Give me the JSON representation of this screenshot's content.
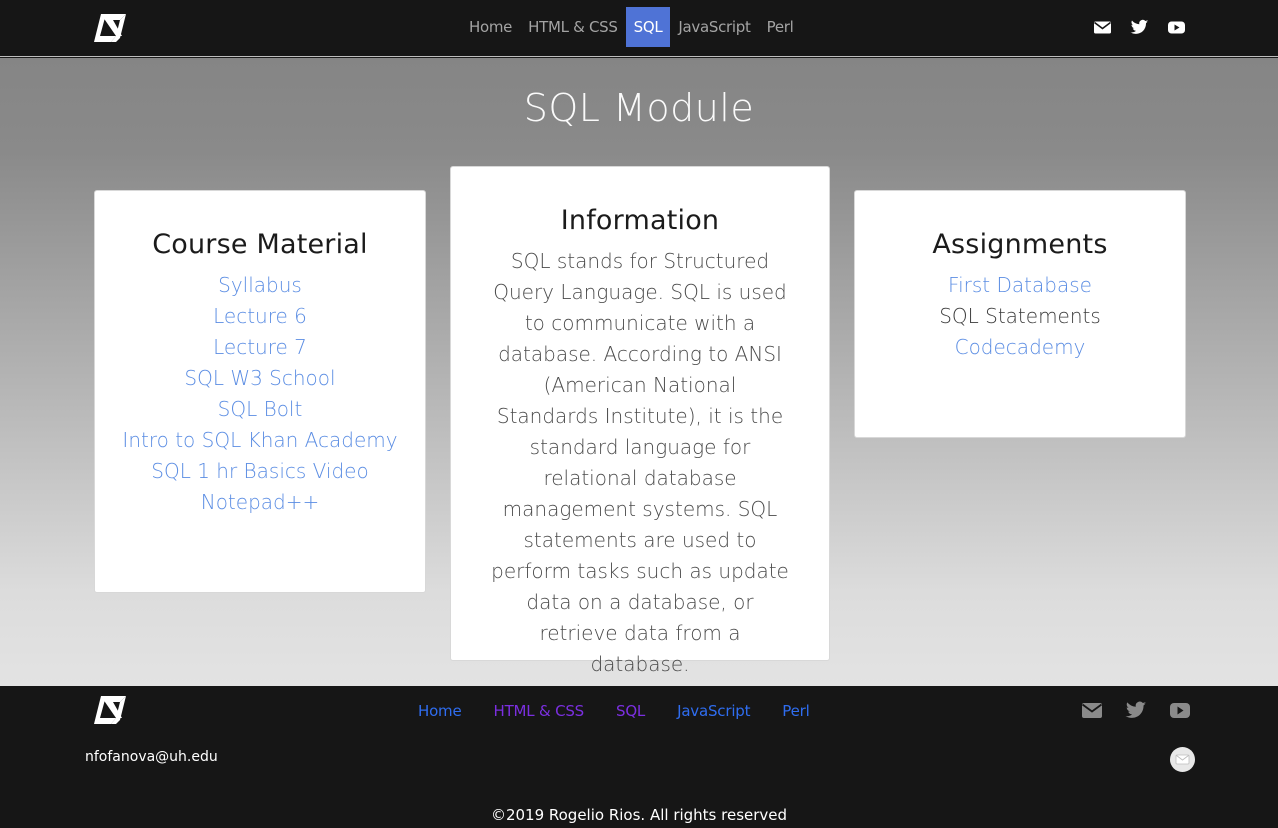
{
  "header": {
    "logo_icon": "n-logo-icon",
    "nav": [
      {
        "label": "Home"
      },
      {
        "label": "HTML & CSS"
      },
      {
        "label": "SQL"
      },
      {
        "label": "JavaScript"
      },
      {
        "label": "Perl"
      }
    ],
    "active_nav": "SQL",
    "social_icons": [
      "envelope-icon",
      "twitter-icon",
      "youtube-icon"
    ]
  },
  "main": {
    "title": "SQL Module",
    "course_material": {
      "heading": "Course Material",
      "links": [
        "Syllabus",
        "Lecture 6",
        "Lecture 7",
        "SQL W3 School",
        "SQL Bolt",
        "Intro to SQL Khan Academy",
        "SQL 1 hr Basics Video",
        "Notepad++"
      ]
    },
    "information": {
      "heading": "Information",
      "body": "SQL stands for Structured Query Language. SQL is used to communicate with a database. According to ANSI (American National Standards Institute), it is the standard language for relational database management systems. SQL statements are used to perform tasks such as update data on a database, or retrieve data from a database."
    },
    "assignments": {
      "heading": "Assignments",
      "items": [
        {
          "label": "First Database",
          "link": true
        },
        {
          "label": "SQL Statements",
          "link": false
        },
        {
          "label": "Codecademy",
          "link": true
        }
      ]
    }
  },
  "footer": {
    "nav": [
      {
        "label": "Home"
      },
      {
        "label": "HTML & CSS"
      },
      {
        "label": "SQL"
      },
      {
        "label": "JavaScript"
      },
      {
        "label": "Perl"
      }
    ],
    "social_icons": [
      "envelope-icon",
      "twitter-icon",
      "youtube-icon"
    ],
    "email": "nfofanova@uh.edu",
    "copyright": "©2019 Rogelio Rios. All rights reserved"
  },
  "colors": {
    "accent": "#4f73d6",
    "link": "#5b8de3",
    "footer_link_unvisited": "#2f6df0",
    "footer_link_visited": "#7b2fe0"
  }
}
